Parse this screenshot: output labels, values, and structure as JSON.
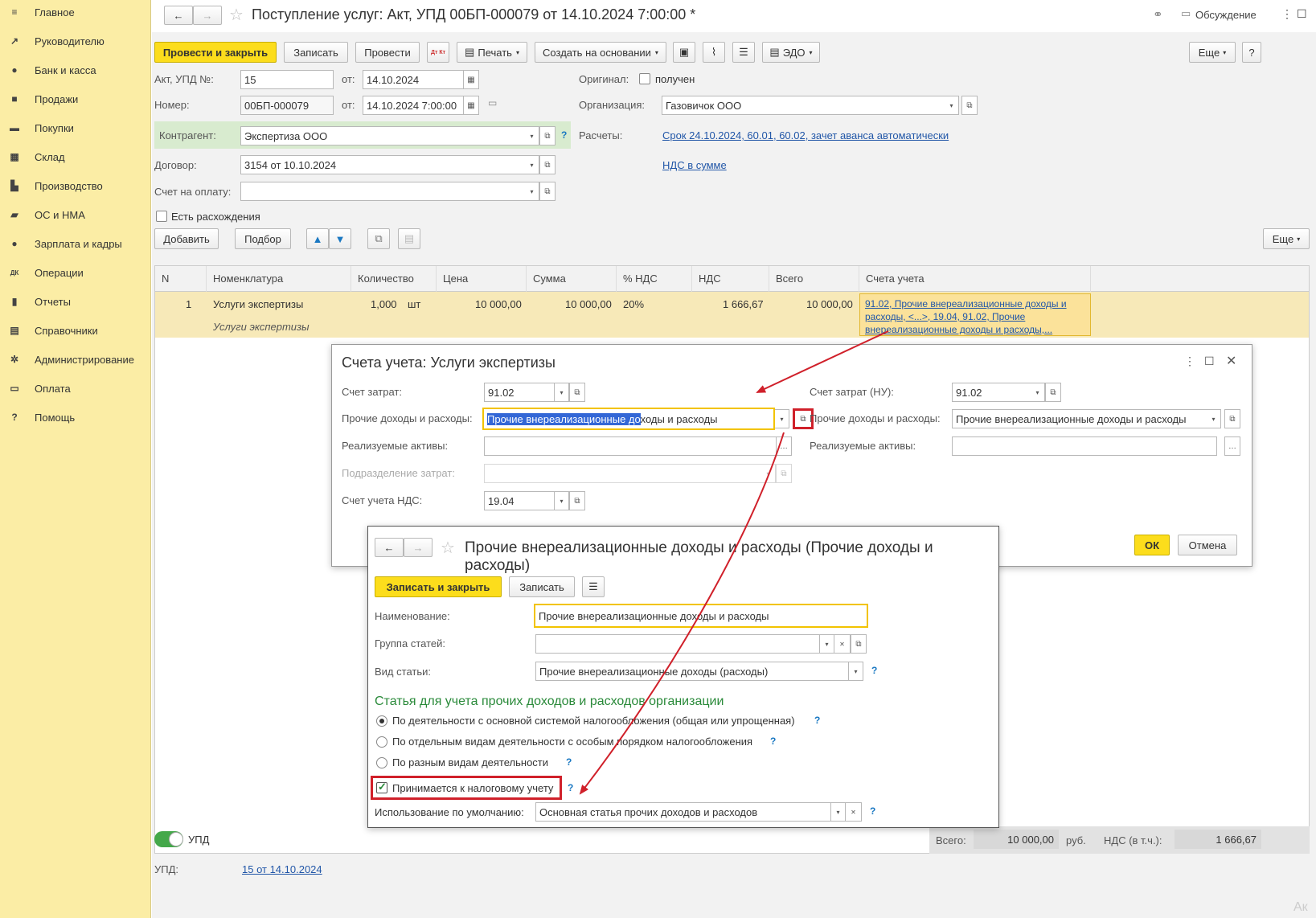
{
  "sidebar": {
    "items": [
      {
        "label": "Главное",
        "icon": "menu-icon"
      },
      {
        "label": "Руководителю",
        "icon": "chart-line-icon"
      },
      {
        "label": "Банк и касса",
        "icon": "coin-icon"
      },
      {
        "label": "Продажи",
        "icon": "bag-icon"
      },
      {
        "label": "Покупки",
        "icon": "cart-icon"
      },
      {
        "label": "Склад",
        "icon": "grid-icon"
      },
      {
        "label": "Производство",
        "icon": "factory-icon"
      },
      {
        "label": "ОС и НМА",
        "icon": "truck-icon"
      },
      {
        "label": "Зарплата и кадры",
        "icon": "person-icon"
      },
      {
        "label": "Операции",
        "icon": "dt-kt-icon"
      },
      {
        "label": "Отчеты",
        "icon": "bar-chart-icon"
      },
      {
        "label": "Справочники",
        "icon": "book-icon"
      },
      {
        "label": "Администрирование",
        "icon": "gear-icon"
      },
      {
        "label": "Оплата",
        "icon": "card-icon"
      },
      {
        "label": "Помощь",
        "icon": "question-icon"
      }
    ]
  },
  "header": {
    "title": "Поступление услуг: Акт, УПД 00БП-000079 от 14.10.2024 7:00:00 *",
    "discussion": "Обсуждение"
  },
  "toolbar": {
    "post_close": "Провести и закрыть",
    "save": "Записать",
    "post": "Провести",
    "dtkt": "Дт Кт",
    "print": "Печать",
    "create_based": "Создать на основании",
    "edo": "ЭДО",
    "more": "Еще"
  },
  "form": {
    "act_label": "Акт, УПД №:",
    "act_value": "15",
    "from_label": "от:",
    "act_date": "14.10.2024",
    "number_label": "Номер:",
    "number_value": "00БП-000079",
    "number_date": "14.10.2024  7:00:00",
    "original_label": "Оригинал:",
    "original_received": "получен",
    "org_label": "Организация:",
    "org_value": "Газовичок ООО",
    "contractor_label": "Контрагент:",
    "contractor_value": "Экспертиза ООО",
    "payments_label": "Расчеты:",
    "payments_link": "Срок 24.10.2024, 60.01, 60.02, зачет аванса автоматически",
    "contract_label": "Договор:",
    "contract_value": "3154 от 10.10.2024",
    "vat_link": "НДС в сумме",
    "invoice_label": "Счет на оплату:",
    "invoice_value": "",
    "discrepancy_label": "Есть расхождения"
  },
  "table_toolbar": {
    "add": "Добавить",
    "pick": "Подбор",
    "more": "Еще"
  },
  "table": {
    "columns": [
      "N",
      "Номенклатура",
      "Количество",
      "Цена",
      "Сумма",
      "% НДС",
      "НДС",
      "Всего",
      "Счета учета"
    ],
    "rows": [
      {
        "n": "1",
        "item": "Услуги экспертизы",
        "item_sub": "Услуги экспертизы",
        "qty": "1,000",
        "unit": "шт",
        "price": "10 000,00",
        "sum": "10 000,00",
        "vat_rate": "20%",
        "vat": "1 666,67",
        "total": "10 000,00",
        "accounts": "91.02, Прочие внереализационные доходы и расходы, <...>, 19.04, 91.02, Прочие внереализационные доходы и расходы,..."
      }
    ]
  },
  "footer": {
    "upd_toggle": "УПД",
    "upd_label": "УПД:",
    "upd_link": "15 от 14.10.2024",
    "total_label": "Всего:",
    "total_value": "10 000,00",
    "currency": "руб.",
    "vat_label": "НДС (в т.ч.):",
    "vat_value": "1 666,67"
  },
  "dialog1": {
    "title": "Счета учета: Услуги экспертизы",
    "cost_account_label": "Счет затрат:",
    "cost_account_value": "91.02",
    "other_label": "Прочие доходы и расходы:",
    "other_value_selected": "Прочие внереализационные до",
    "other_value_rest": "ходы и расходы",
    "assets_label": "Реализуемые активы:",
    "subdivision_label": "Подразделение затрат:",
    "vat_account_label": "Счет учета НДС:",
    "vat_account_value": "19.04",
    "cost_account_nu_label": "Счет затрат (НУ):",
    "cost_account_nu_value": "91.02",
    "other_nu_label": "Прочие доходы и расходы:",
    "other_nu_value": "Прочие внереализационные доходы и расходы",
    "assets_nu_label": "Реализуемые активы:",
    "ok": "ОК",
    "cancel": "Отмена"
  },
  "dialog2": {
    "title": "Прочие внереализационные доходы и расходы (Прочие доходы и расходы)",
    "save_close": "Записать и закрыть",
    "save": "Записать",
    "name_label": "Наименование:",
    "name_value": "Прочие внереализационные доходы и расходы",
    "group_label": "Группа статей:",
    "group_value": "",
    "kind_label": "Вид статьи:",
    "kind_value": "Прочие внереализационные доходы (расходы)",
    "section_title": "Статья для учета прочих доходов и расходов организации",
    "radio1": "По деятельности с основной системой налогообложения (общая или упрощенная)",
    "radio2": "По отдельным видам деятельности с особым порядком налогообложения",
    "radio3": "По разным видам деятельности",
    "tax_accept": "Принимается к налоговому учету",
    "default_use_label": "Использование по умолчанию:",
    "default_use_value": "Основная статья прочих доходов и расходов"
  },
  "watermark": "Ак"
}
